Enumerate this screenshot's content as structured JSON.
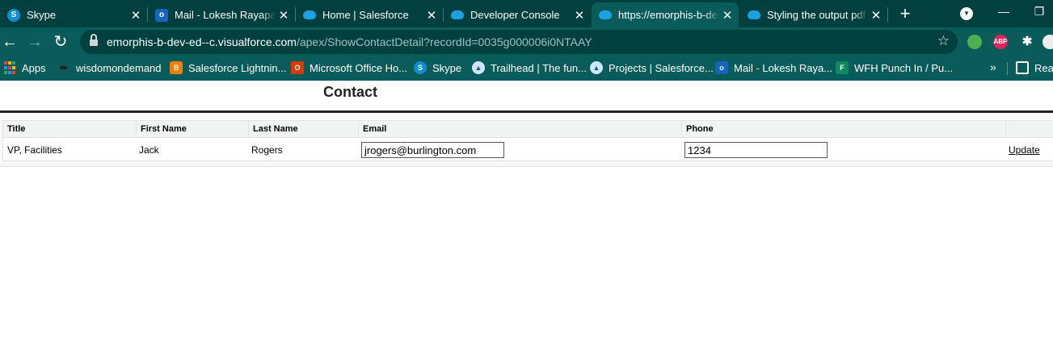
{
  "tabs": [
    {
      "title": "Skype",
      "favicon": "S"
    },
    {
      "title": "Mail - Lokesh Rayapati - Outlook",
      "favicon": "o"
    },
    {
      "title": "Home | Salesforce",
      "favicon": ""
    },
    {
      "title": "Developer Console",
      "favicon": ""
    },
    {
      "title": "https://emorphis-b-dev-ed--c.visualforce.com",
      "favicon": ""
    },
    {
      "title": "Styling the output pdf",
      "favicon": ""
    }
  ],
  "tabstrip": {
    "new_tab": "+",
    "close": "✕",
    "search": "▼",
    "minimize": "—",
    "maximize": "❐"
  },
  "toolbar": {
    "back": "←",
    "forward": "→",
    "reload": "↻",
    "url_host": "emorphis-b-dev-ed--c.visualforce.com",
    "url_path": "/apex/ShowContactDetail?recordId=0035g000006i0NTAAY",
    "bookmark_star": "☆",
    "extensions": {
      "abp": "ABP",
      "puzzle": "✱",
      "globe": "",
      "avatar": ""
    }
  },
  "bookmarks": [
    {
      "label": "Apps"
    },
    {
      "label": "wisdomondemand"
    },
    {
      "label": "Salesforce Lightnin..."
    },
    {
      "label": "Microsoft Office Ho..."
    },
    {
      "label": "Skype"
    },
    {
      "label": "Trailhead | The fun..."
    },
    {
      "label": "Projects | Salesforce..."
    },
    {
      "label": "Mail - Lokesh Raya..."
    },
    {
      "label": "WFH Punch In / Pu..."
    },
    {
      "label": "Reading list"
    }
  ],
  "bookmark_icons": {
    "skype": "S",
    "outlook": "o",
    "forms": "F",
    "blogger": "B",
    "office": "O",
    "feather": "✒",
    "trail": "▲"
  },
  "bookmarks_more": "»",
  "page": {
    "section_title": "Contact",
    "columns": [
      "Title",
      "First Name",
      "Last Name",
      "Email",
      "Phone"
    ],
    "row": {
      "title": "VP, Facilities",
      "first_name": "Jack",
      "last_name": "Rogers",
      "email": "jrogers@burlington.com",
      "phone": "1234",
      "action": "Update"
    }
  },
  "colors": {
    "tabstrip": "#00403f",
    "toolbar": "#0a5c5a",
    "page_background": "#ffffff",
    "table_header": "#f2f3f3"
  }
}
